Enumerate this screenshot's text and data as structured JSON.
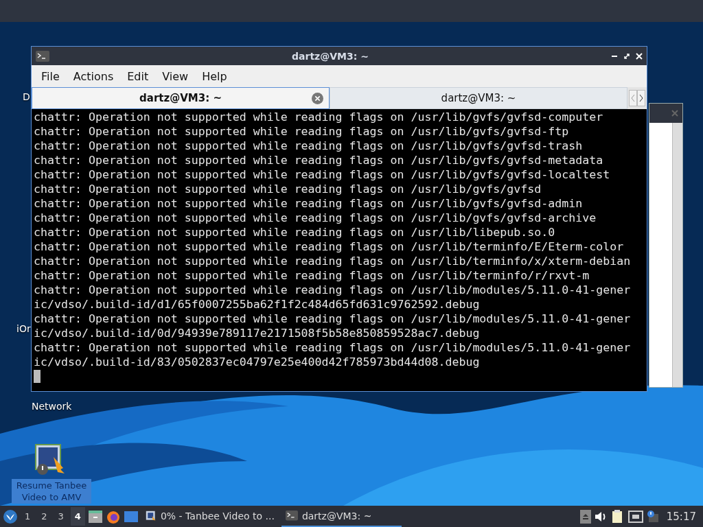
{
  "desktop_icons": [
    {
      "label": "D"
    },
    {
      "label": "iOr"
    },
    {
      "label": "Network"
    },
    {
      "label": "Resume Tanbee Video to AMV",
      "kind": "app"
    }
  ],
  "terminal": {
    "title": "dartz@VM3: ~",
    "menu": [
      "File",
      "Actions",
      "Edit",
      "View",
      "Help"
    ],
    "tabs": [
      {
        "label": "dartz@VM3: ~",
        "selected": true
      },
      {
        "label": "dartz@VM3: ~",
        "selected": false
      }
    ],
    "lines": [
      "chattr: Operation not supported while reading flags on /usr/lib/gvfs/gvfsd-computer",
      "chattr: Operation not supported while reading flags on /usr/lib/gvfs/gvfsd-ftp",
      "chattr: Operation not supported while reading flags on /usr/lib/gvfs/gvfsd-trash",
      "chattr: Operation not supported while reading flags on /usr/lib/gvfs/gvfsd-metadata",
      "chattr: Operation not supported while reading flags on /usr/lib/gvfs/gvfsd-localtest",
      "chattr: Operation not supported while reading flags on /usr/lib/gvfs/gvfsd",
      "chattr: Operation not supported while reading flags on /usr/lib/gvfs/gvfsd-admin",
      "chattr: Operation not supported while reading flags on /usr/lib/gvfs/gvfsd-archive",
      "chattr: Operation not supported while reading flags on /usr/lib/libepub.so.0",
      "chattr: Operation not supported while reading flags on /usr/lib/terminfo/E/Eterm-color",
      "chattr: Operation not supported while reading flags on /usr/lib/terminfo/x/xterm-debian",
      "chattr: Operation not supported while reading flags on /usr/lib/terminfo/r/rxvt-m",
      "chattr: Operation not supported while reading flags on /usr/lib/modules/5.11.0-41-gener",
      "ic/vdso/.build-id/d1/65f0007255ba62f1f2c484d65fd631c9762592.debug",
      "chattr: Operation not supported while reading flags on /usr/lib/modules/5.11.0-41-gener",
      "ic/vdso/.build-id/0d/94939e789117e2171508f5b58e850859528ac7.debug",
      "chattr: Operation not supported while reading flags on /usr/lib/modules/5.11.0-41-gener",
      "ic/vdso/.build-id/83/0502837ec04797e25e400d42f785973bd44d08.debug"
    ]
  },
  "taskbar": {
    "workspaces": [
      {
        "label": "1",
        "selected": false
      },
      {
        "label": "2",
        "selected": false
      },
      {
        "label": "3",
        "selected": false
      },
      {
        "label": "4",
        "selected": true
      }
    ],
    "tasks": [
      {
        "label": "0% - Tanbee Video to ...",
        "selected": false,
        "kind": "app"
      },
      {
        "label": "dartz@VM3: ~",
        "selected": true,
        "kind": "terminal"
      }
    ],
    "clock": "15:17"
  }
}
